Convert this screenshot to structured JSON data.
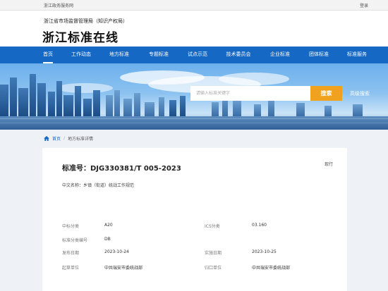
{
  "topbar": {
    "portal": "浙江政务服务网",
    "login": "登录"
  },
  "header": {
    "org": "浙江省市场监督管理局（知识产权局）",
    "site": "浙江标准在线"
  },
  "nav": {
    "items": [
      {
        "label": "首页",
        "active": true
      },
      {
        "label": "工作动态"
      },
      {
        "label": "地方标准"
      },
      {
        "label": "专题标准"
      },
      {
        "label": "试点示范"
      },
      {
        "label": "技术委员会"
      },
      {
        "label": "企业标准"
      },
      {
        "label": "团体标准"
      },
      {
        "label": "标准服务"
      }
    ]
  },
  "search": {
    "placeholder": "请输入标准关键字",
    "button": "搜索",
    "advanced": "高级搜索"
  },
  "breadcrumb": {
    "home": "首页",
    "separator": "/",
    "current": "地方标准详情"
  },
  "detail": {
    "standard_no": "标准号：DJG330381/T 005-2023",
    "status": "现行",
    "cn_name": "中文名称：乡镇（街道）统战工作规范",
    "fields": {
      "ccs_label": "中标分类",
      "ccs_value": "A20",
      "ics_label": "ICS分类",
      "ics_value": "03.160",
      "record_label": "标准分类编号",
      "record_value": "DB",
      "publish_label": "发布日期",
      "publish_value": "2023-10-24",
      "impl_label": "实施日期",
      "impl_value": "2023-10-25",
      "draft_label": "起草单位",
      "draft_value": "中共瑞安市委统战部",
      "mgmt_label": "归口单位",
      "mgmt_value": "中共瑞安市委统战部"
    }
  },
  "colors": {
    "nav": "#1568c4",
    "search_button": "#f0a21e",
    "page_bg": "#eef1f6"
  }
}
